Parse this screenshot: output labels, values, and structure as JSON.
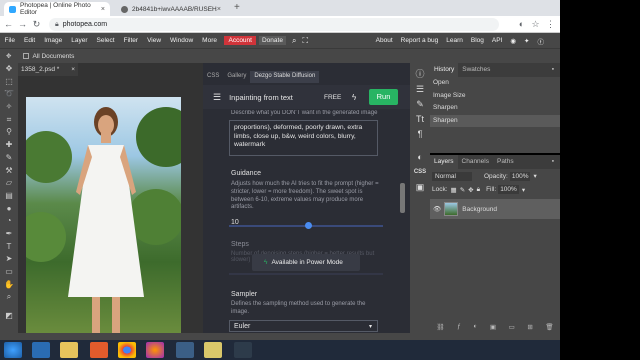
{
  "browser": {
    "tabs": [
      {
        "title": "Photopea | Online Photo Editor"
      },
      {
        "title": "2b4841b+iwvAAAAB/RUSEH/ka..."
      }
    ],
    "new_tab": "+",
    "url": "photopea.com"
  },
  "menubar": {
    "items": [
      "File",
      "Edit",
      "Image",
      "Layer",
      "Select",
      "Filter",
      "View",
      "Window",
      "More"
    ],
    "account": "Account",
    "donate": "Donate",
    "right": [
      "About",
      "Report a bug",
      "Learn",
      "Blog",
      "API"
    ]
  },
  "options": {
    "all_documents": "All Documents"
  },
  "document": {
    "tab": "1358_2.psd *"
  },
  "plugin": {
    "tabs": [
      "CSS",
      "Gallery",
      "Dezgo Stable Diffusion"
    ],
    "title": "Inpainting from text",
    "free": "FREE",
    "run": "Run",
    "neg_hint": "Describe what you DON'T want in the generated image",
    "neg_text": "proportions), deformed, poorly drawn, extra limbs, close up, b&w, weird colors, blurry, watermark",
    "guidance": {
      "title": "Guidance",
      "desc": "Adjusts how much the AI tries to fit the prompt (higher = stricter, lower = more freedom). The sweet spot is between 6-10, extreme values may produce more artifacts.",
      "value": "10"
    },
    "steps": {
      "title": "Steps",
      "desc": "Number of denoising steps (higher = better results but slower)"
    },
    "toast": "Available in Power Mode",
    "sampler": {
      "title": "Sampler",
      "desc": "Defines the sampling method used to generate the image.",
      "value": "Euler"
    }
  },
  "history": {
    "tabs": [
      "History",
      "Swatches"
    ],
    "items": [
      "Open",
      "Image Size",
      "Sharpen",
      "Sharpen"
    ]
  },
  "layers": {
    "tabs": [
      "Layers",
      "Channels",
      "Paths"
    ],
    "blend": "Normal",
    "opacity_label": "Opacity:",
    "opacity": "100%",
    "lock_label": "Lock:",
    "fill_label": "Fill:",
    "fill": "100%",
    "layer_name": "Background"
  },
  "colors": {
    "accent_run": "#28b463",
    "account": "#d0343a"
  }
}
